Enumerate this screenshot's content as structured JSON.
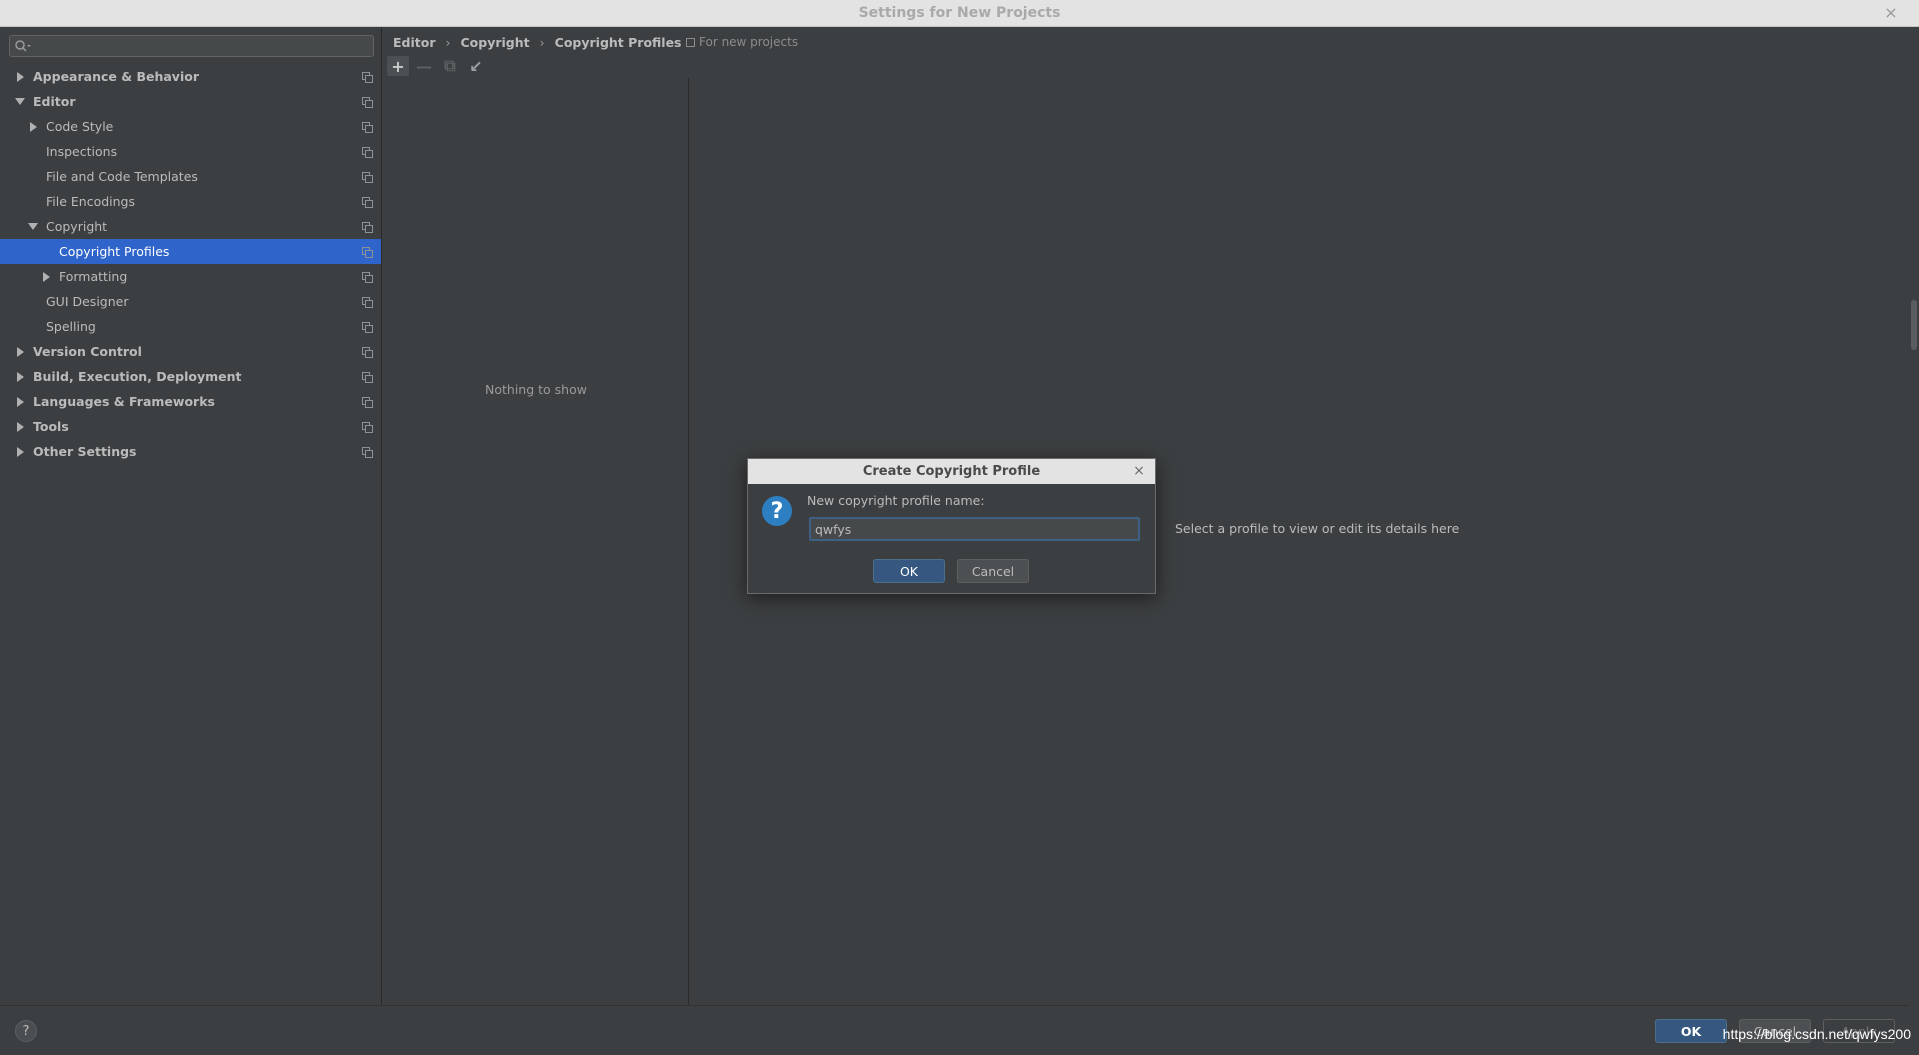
{
  "window": {
    "title": "Settings for New Projects"
  },
  "sidebar": {
    "search_placeholder": "",
    "items": [
      {
        "label": "Appearance & Behavior",
        "level": 0,
        "bold": true,
        "arrow": "right"
      },
      {
        "label": "Editor",
        "level": 0,
        "bold": true,
        "arrow": "down"
      },
      {
        "label": "Code Style",
        "level": 1,
        "bold": false,
        "arrow": "right"
      },
      {
        "label": "Inspections",
        "level": 1,
        "bold": false,
        "arrow": ""
      },
      {
        "label": "File and Code Templates",
        "level": 1,
        "bold": false,
        "arrow": ""
      },
      {
        "label": "File Encodings",
        "level": 1,
        "bold": false,
        "arrow": ""
      },
      {
        "label": "Copyright",
        "level": 1,
        "bold": false,
        "arrow": "down"
      },
      {
        "label": "Copyright Profiles",
        "level": 2,
        "bold": false,
        "arrow": "",
        "selected": true
      },
      {
        "label": "Formatting",
        "level": 2,
        "bold": false,
        "arrow": "right"
      },
      {
        "label": "GUI Designer",
        "level": 1,
        "bold": false,
        "arrow": ""
      },
      {
        "label": "Spelling",
        "level": 1,
        "bold": false,
        "arrow": ""
      },
      {
        "label": "Version Control",
        "level": 0,
        "bold": true,
        "arrow": "right"
      },
      {
        "label": "Build, Execution, Deployment",
        "level": 0,
        "bold": true,
        "arrow": "right"
      },
      {
        "label": "Languages & Frameworks",
        "level": 0,
        "bold": true,
        "arrow": "right"
      },
      {
        "label": "Tools",
        "level": 0,
        "bold": true,
        "arrow": "right"
      },
      {
        "label": "Other Settings",
        "level": 0,
        "bold": true,
        "arrow": "right"
      }
    ]
  },
  "breadcrumb": {
    "items": [
      "Editor",
      "Copyright",
      "Copyright Profiles"
    ],
    "separator": "›",
    "scope_note": "For new projects"
  },
  "toolbar": {
    "add": "+",
    "remove": "—",
    "copy": "⧉",
    "import": "↙"
  },
  "list_pane": {
    "empty_text": "Nothing to show"
  },
  "detail_pane": {
    "hint": "Select a profile to view or edit its details here"
  },
  "footer": {
    "help": "?",
    "ok": "OK",
    "cancel": "Cancel",
    "apply": "Apply",
    "watermark": "https://blog.csdn.net/qwfys200"
  },
  "dialog": {
    "title": "Create Copyright Profile",
    "close": "×",
    "icon": "?",
    "label": "New copyright profile name:",
    "input_value": "qwfys",
    "ok": "OK",
    "cancel": "Cancel"
  },
  "colors": {
    "background": "#3c3f41",
    "selection": "#2f65ca",
    "primary_button": "#365880",
    "question_icon": "#2d7fc1"
  }
}
